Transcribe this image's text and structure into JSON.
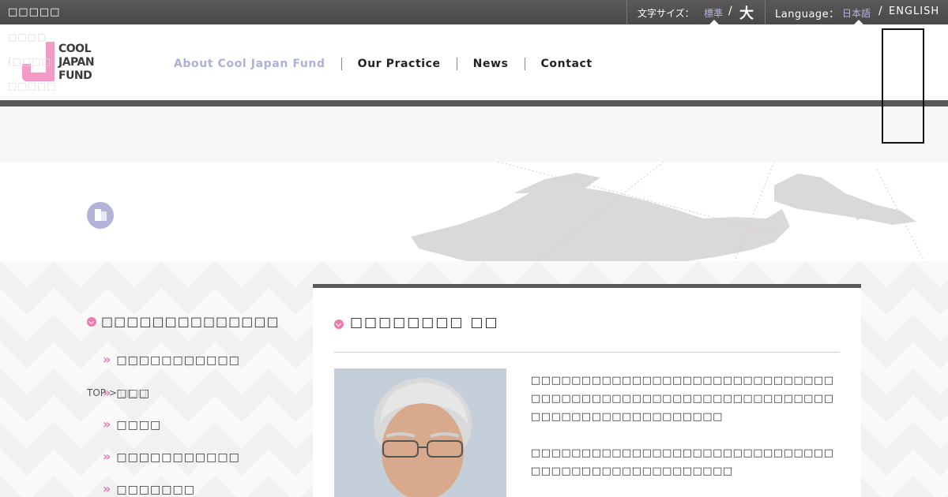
{
  "topbar": {
    "site_label": "□□□□□",
    "font_size_label": "文字サイズ：",
    "font_size_standard": "標準",
    "font_size_sep": "/",
    "font_size_large": "大",
    "language_label": "Language：",
    "language_jp": "日本語",
    "language_sep": "/",
    "language_en": "ENGLISH"
  },
  "logo": {
    "line1": "COOL",
    "line2": "JAPAN",
    "line3": "FUND"
  },
  "side_text": [
    "□□□□",
    "(□□□□",
    "□□□□□",
    "□□□□",
    "□)"
  ],
  "nav": {
    "items": [
      {
        "label": "About Cool Japan Fund"
      },
      {
        "label": "Our Practice"
      },
      {
        "label": "News"
      },
      {
        "label": "Contact"
      }
    ]
  },
  "sidenav": {
    "title": "□□□□□□□□□□□□□□",
    "items": [
      {
        "label": "□□□□□□□□□□□"
      },
      {
        "label": "□□□"
      },
      {
        "label": "□□□□"
      },
      {
        "label": "□□□□□□□□□□□"
      },
      {
        "label": "□□□□□□□"
      }
    ],
    "bullet": "»"
  },
  "breadcrumb": {
    "top": "TOP",
    "sep": ">",
    "current": "□□□"
  },
  "panel": {
    "title": "□□□□□□□□ □□",
    "paragraphs": [
      "□□□□□□□□□□□□□□□□□□□□□□□□□□□□□□□□□□□□□□□□□□□□□□□□□□□□□□□□□□□□□□□□□□□□□□□□□□□□□□□",
      "□□□□□□□□□□□□□□□□□□□□□□□□□□□□□□□□□□□□□□□□□□□□□□□□□□"
    ]
  },
  "colors": {
    "accent_pink": "#e87bb0",
    "accent_lavender": "#b3b2d8",
    "bar_gray": "#5b5859"
  },
  "icons": {
    "hero": "building-icon",
    "bullet": "chevron-down-circle-icon"
  }
}
